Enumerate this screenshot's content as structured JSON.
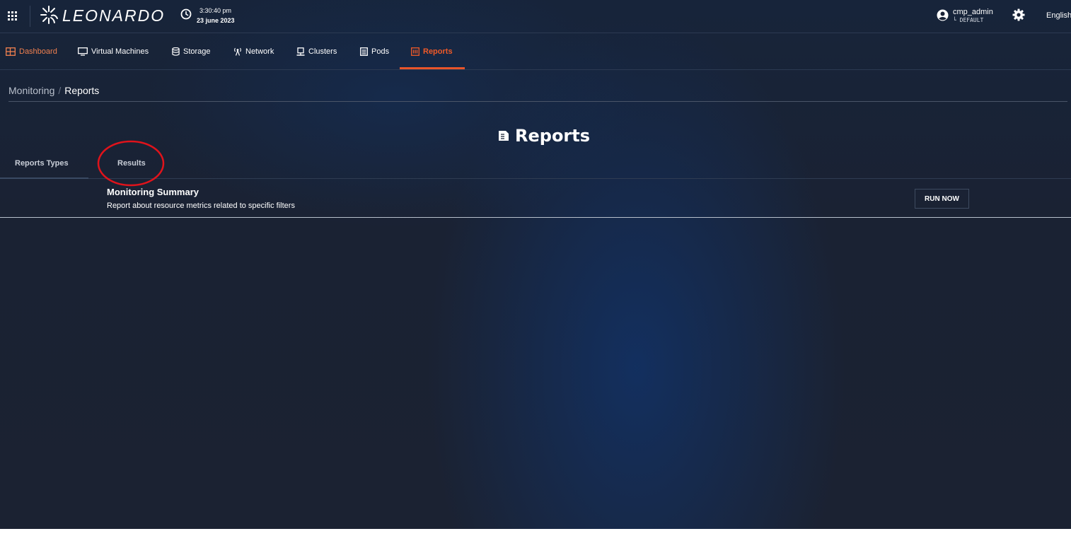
{
  "header": {
    "brand": "LEONARDO",
    "clock": {
      "time": "3:30:40 pm",
      "date": "23 june 2023"
    },
    "user": {
      "name": "cmp_admin",
      "tenant": "└ DEFAULT"
    },
    "language": "English"
  },
  "nav": {
    "items": [
      {
        "label": "Dashboard",
        "icon": "dashboard-icon"
      },
      {
        "label": "Virtual Machines",
        "icon": "monitor-icon"
      },
      {
        "label": "Storage",
        "icon": "database-icon"
      },
      {
        "label": "Network",
        "icon": "antenna-icon"
      },
      {
        "label": "Clusters",
        "icon": "cluster-icon"
      },
      {
        "label": "Pods",
        "icon": "pod-icon"
      },
      {
        "label": "Reports",
        "icon": "report-icon"
      }
    ],
    "active": "Reports"
  },
  "breadcrumb": {
    "parent": "Monitoring",
    "separator": "/",
    "current": "Reports"
  },
  "page": {
    "title": "Reports",
    "title_icon": "report-document-icon"
  },
  "tabs": [
    {
      "label": "Reports Types"
    },
    {
      "label": "Results"
    }
  ],
  "reports": [
    {
      "title": "Monitoring Summary",
      "description": "Report about resource metrics related to specific filters",
      "action_label": "RUN NOW"
    }
  ],
  "colors": {
    "accent": "#f05a28",
    "background": "#1b2232",
    "annotation": "#e0131b"
  }
}
